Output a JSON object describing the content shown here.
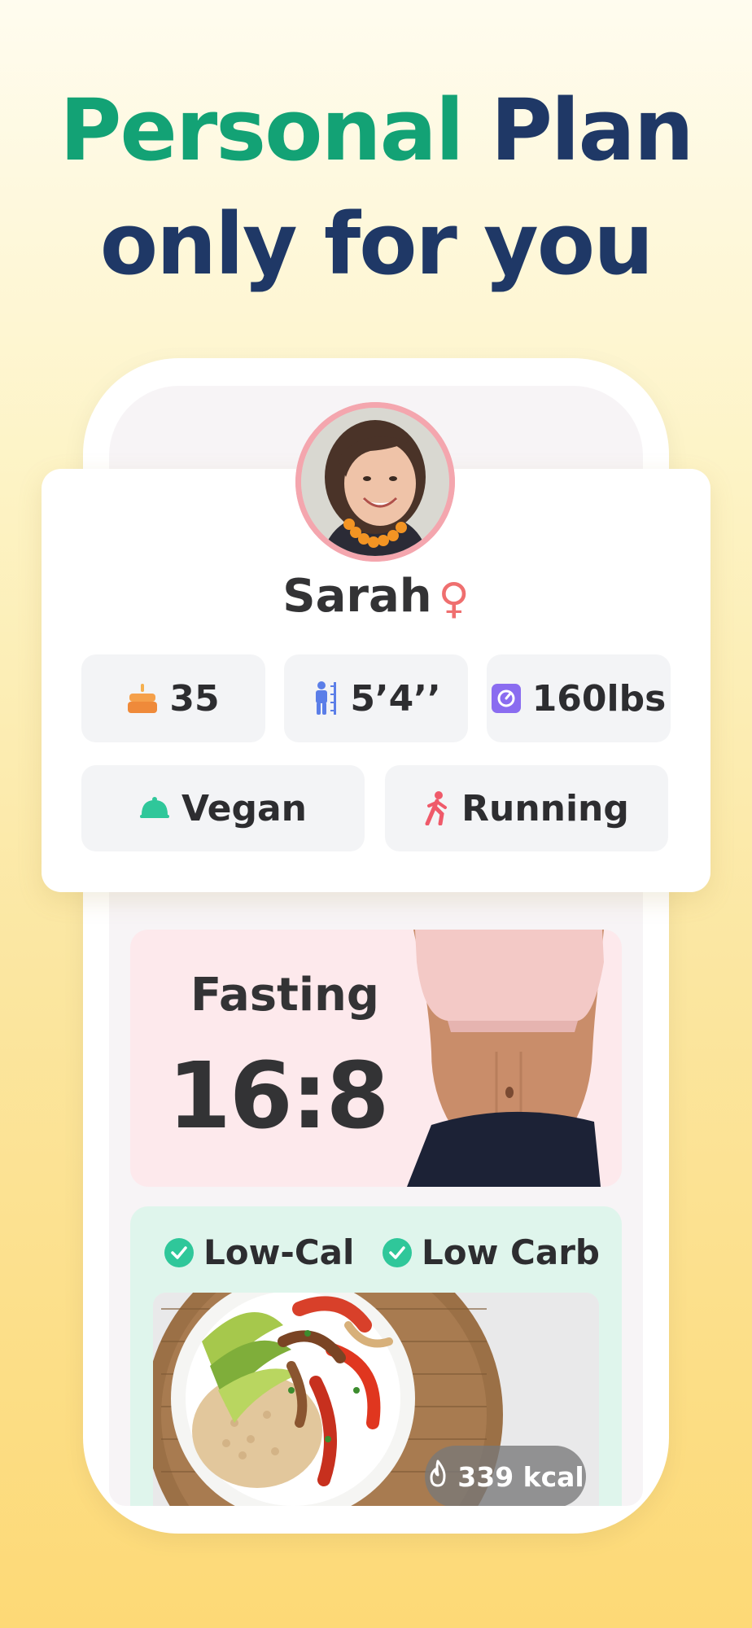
{
  "headline": {
    "line1_green": "Personal",
    "line1_navy": "Plan",
    "line2": "only for you"
  },
  "profile": {
    "name": "Sarah",
    "gender_icon": "female-icon",
    "stats": [
      {
        "icon": "cake-icon",
        "value": "35"
      },
      {
        "icon": "height-icon",
        "value": "5’4’’"
      },
      {
        "icon": "scale-icon",
        "value": "160lbs"
      }
    ],
    "preferences": [
      {
        "icon": "food-cloche-icon",
        "value": "Vegan"
      },
      {
        "icon": "running-icon",
        "value": "Running"
      }
    ]
  },
  "fasting": {
    "title": "Fasting",
    "ratio": "16:8"
  },
  "meal": {
    "tags": [
      "Low-Cal",
      "Low Carb"
    ],
    "calories": "339 kcal"
  },
  "colors": {
    "accent_green": "#13a275",
    "navy": "#1f3866",
    "fasting_bg": "#fde9ec",
    "meal_bg": "#dff5ec",
    "check_green": "#2fc79a",
    "female_pink": "#ef6f6f"
  }
}
